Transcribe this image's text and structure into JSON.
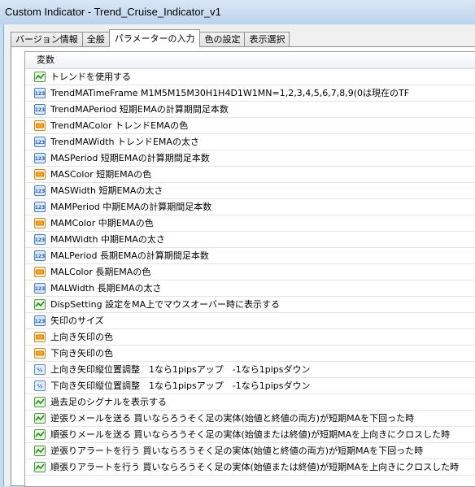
{
  "window": {
    "title": "Custom Indicator - Trend_Cruise_Indicator_v1"
  },
  "tabs": [
    {
      "label": "バージョン情報"
    },
    {
      "label": "全般"
    },
    {
      "label": "パラメーターの入力"
    },
    {
      "label": "色の設定"
    },
    {
      "label": "表示選択"
    }
  ],
  "grid": {
    "column_header": "変数",
    "rows": [
      {
        "icon": "bool-icon",
        "label": "トレンドを使用する"
      },
      {
        "icon": "int-icon",
        "label": "TrendMATimeFrame M1M5M15M30H1H4D1W1MN=1,2,3,4,5,6,7,8,9(0は現在のTF"
      },
      {
        "icon": "int-icon",
        "label": "TrendMAPeriod 短期EMAの計算期間足本数"
      },
      {
        "icon": "color-icon",
        "label": "TrendMAColor トレンドEMAの色"
      },
      {
        "icon": "int-icon",
        "label": "TrendMAWidth トレンドEMAの太さ"
      },
      {
        "icon": "int-icon",
        "label": "MASPeriod 短期EMAの計算期間足本数"
      },
      {
        "icon": "color-icon",
        "label": "MASColor 短期EMAの色"
      },
      {
        "icon": "int-icon",
        "label": "MASWidth 短期EMAの太さ"
      },
      {
        "icon": "int-icon",
        "label": "MAMPeriod 中期EMAの計算期間足本数"
      },
      {
        "icon": "color-icon",
        "label": "MAMColor 中期EMAの色"
      },
      {
        "icon": "int-icon",
        "label": "MAMWidth 中期EMAの太さ"
      },
      {
        "icon": "int-icon",
        "label": "MALPeriod 長期EMAの計算期間足本数"
      },
      {
        "icon": "color-icon",
        "label": "MALColor 長期EMAの色"
      },
      {
        "icon": "int-icon",
        "label": "MALWidth 長期EMAの太さ"
      },
      {
        "icon": "bool-icon",
        "label": "DispSetting 設定をMA上でマウスオーバー時に表示する"
      },
      {
        "icon": "int-icon",
        "label": "矢印のサイズ"
      },
      {
        "icon": "color-icon",
        "label": "上向き矢印の色"
      },
      {
        "icon": "color-icon",
        "label": "下向き矢印の色"
      },
      {
        "icon": "double-icon",
        "label": "上向き矢印縦位置調整　1なら1pipsアップ　-1なら1pipsダウン"
      },
      {
        "icon": "double-icon",
        "label": "下向き矢印縦位置調整　1なら1pipsアップ　-1なら1pipsダウン"
      },
      {
        "icon": "bool-icon",
        "label": "過去足のシグナルを表示する"
      },
      {
        "icon": "bool-icon",
        "label": "逆張りメールを送る 買いならろうそく足の実体(始値と終値の両方)が短期MAを下回った時"
      },
      {
        "icon": "bool-icon",
        "label": "順張りメールを送る 買いならろうそく足の実体(始値または終値)が短期MAを上向きにクロスした時"
      },
      {
        "icon": "bool-icon",
        "label": "逆張りアラートを行う 買いならろうそく足の実体(始値と終値の両方)が短期MAを下回った時"
      },
      {
        "icon": "bool-icon",
        "label": "順張りアラートを行う 買いならろうそく足の実体(始値または終値)が短期MAを上向きにクロスした時"
      }
    ]
  },
  "colors": {
    "window_frame": "#c9dbef",
    "dialog_bg": "#f0f0f0",
    "grid_bg": "#ffffff"
  }
}
